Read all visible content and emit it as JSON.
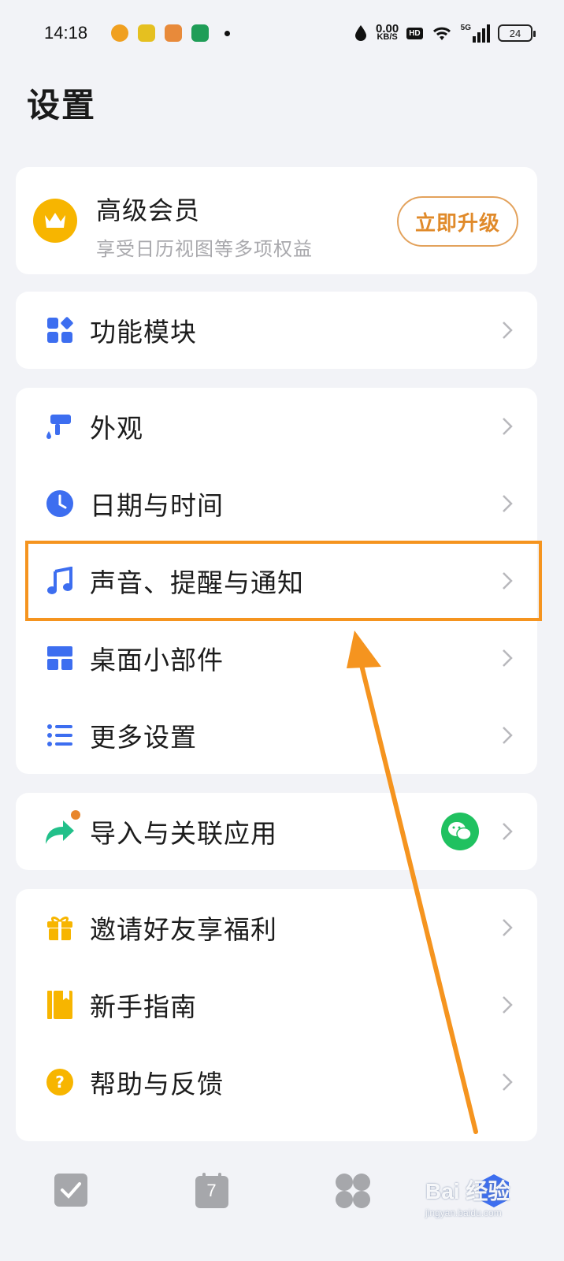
{
  "status_bar": {
    "time": "14:18",
    "net_speed_value": "0.00",
    "net_speed_unit": "KB/S",
    "hd_label": "HD",
    "signal_label": "5G",
    "battery": "24"
  },
  "page": {
    "title": "设置"
  },
  "vip": {
    "title": "高级会员",
    "subtitle": "享受日历视图等多项权益",
    "button": "立即升级"
  },
  "groups": {
    "modules": {
      "label": "功能模块"
    },
    "display": {
      "appearance": "外观",
      "datetime": "日期与时间",
      "sound": "声音、提醒与通知",
      "widget": "桌面小部件",
      "more": "更多设置"
    },
    "import": {
      "label": "导入与关联应用"
    },
    "misc": {
      "invite": "邀请好友享福利",
      "guide": "新手指南",
      "help": "帮助与反馈"
    }
  },
  "tabbar": {
    "calendar_day": "7"
  },
  "watermark": {
    "main": "Bai 经验",
    "sub": "jingyan.baidu.com"
  },
  "colors": {
    "accent_blue": "#3d6ef0",
    "accent_yellow": "#f7b500",
    "highlight_orange": "#f5941f",
    "wechat_green": "#20c160"
  }
}
